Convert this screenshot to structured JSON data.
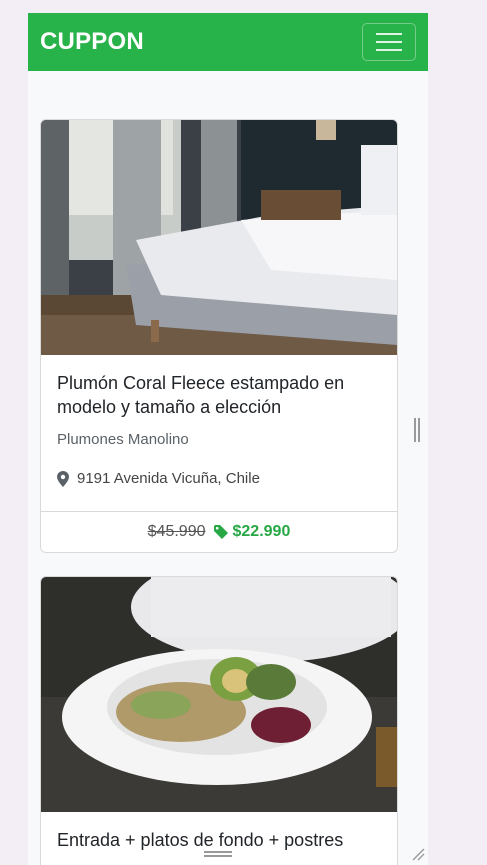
{
  "navbar": {
    "brand": "CUPPON"
  },
  "cards": [
    {
      "title": "Plumón Coral Fleece estampado en modelo y tamaño a elección",
      "seller": "Plumones Manolino",
      "location": "9191 Avenida Vicuña, Chile",
      "old_price": "$45.990",
      "new_price": "$22.990"
    },
    {
      "title": "Entrada + platos de fondo + postres"
    }
  ],
  "colors": {
    "brand_green": "#28b34a",
    "price_green": "#28a745"
  },
  "icons": [
    "menu-icon",
    "map-marker-icon",
    "tag-icon"
  ]
}
